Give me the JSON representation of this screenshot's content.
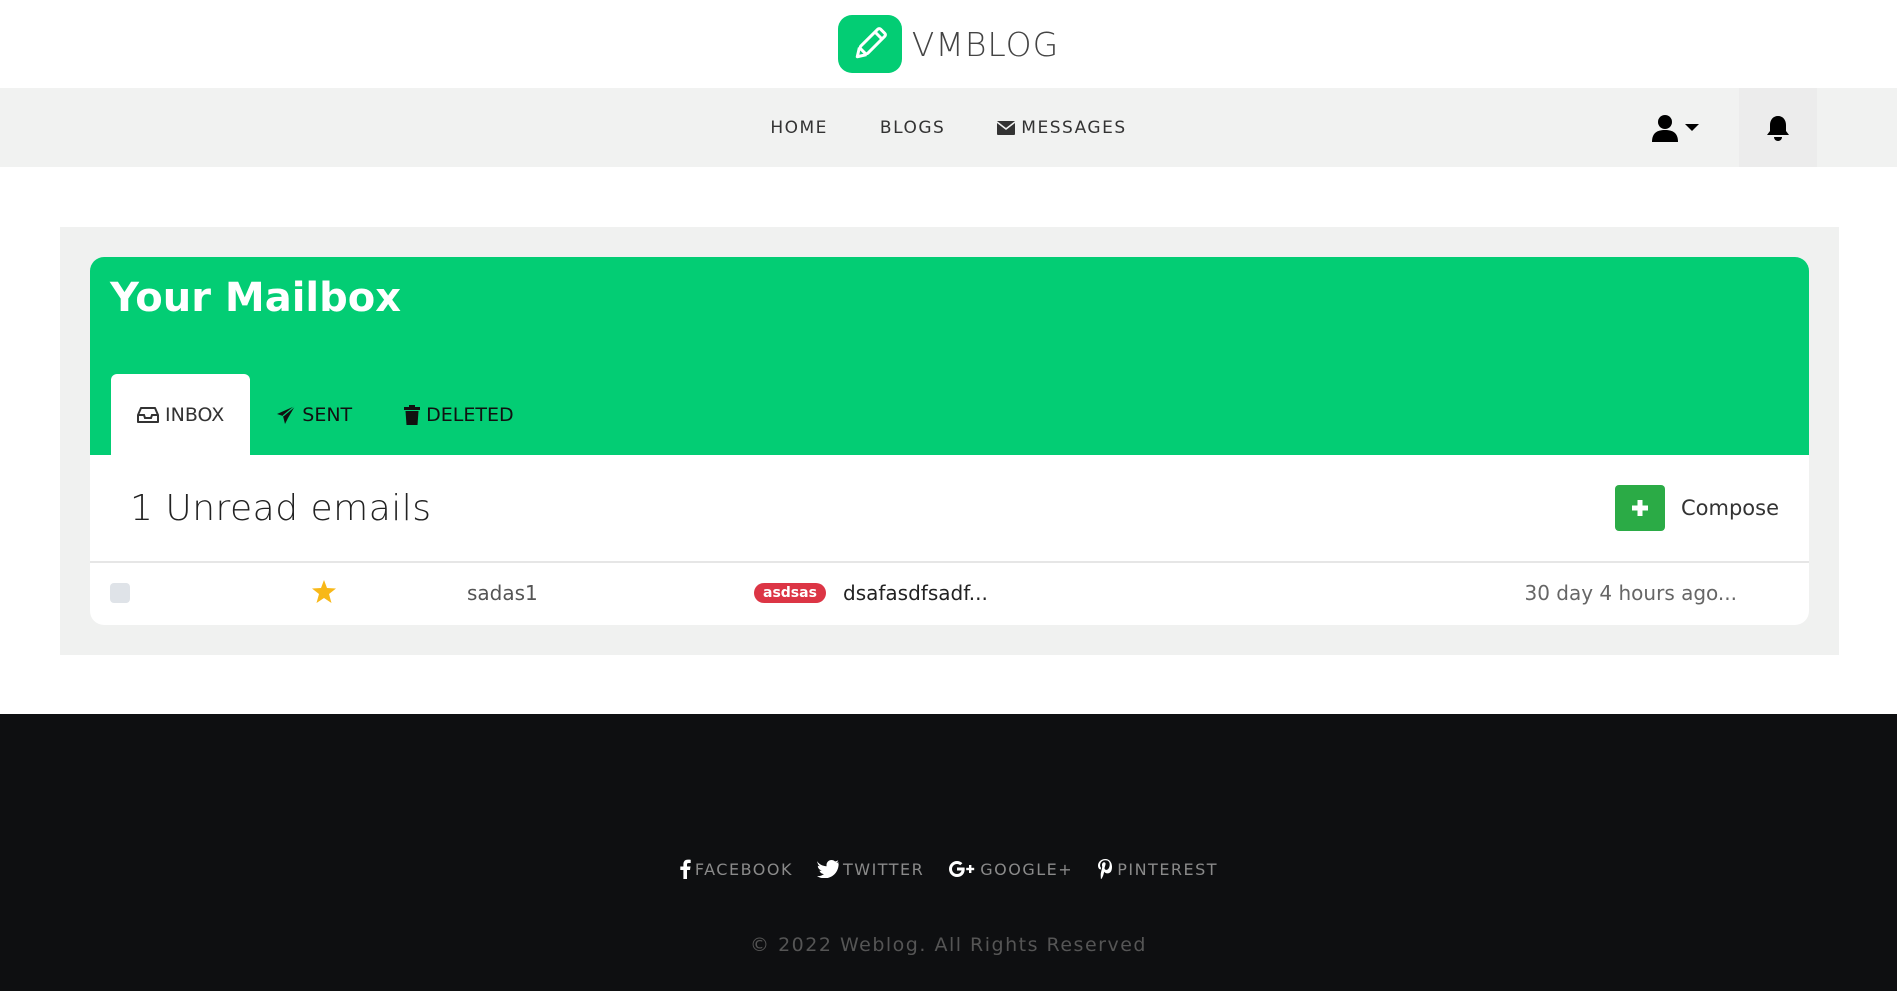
{
  "brand": {
    "name": "VMBLOG",
    "color": "#03cd74"
  },
  "nav": {
    "links": [
      "HOME",
      "BLOGS",
      "MESSAGES"
    ]
  },
  "mailbox": {
    "title": "Your Mailbox",
    "tabs": [
      {
        "label": "INBOX",
        "icon": "inbox-icon",
        "active": true
      },
      {
        "label": "SENT",
        "icon": "paper-plane-icon",
        "active": false
      },
      {
        "label": "DELETED",
        "icon": "trash-icon",
        "active": false
      }
    ],
    "unread_title": "1 Unread emails",
    "compose_label": "Compose",
    "emails": [
      {
        "sender": "sadas1",
        "tag": "asdsas",
        "subject": "dsafasdfsadf...",
        "time": "30 day 4 hours ago...",
        "starred": true
      }
    ]
  },
  "footer": {
    "socials": [
      "FACEBOOK",
      "TWITTER",
      "GOOGLE+",
      "PINTEREST"
    ],
    "copyright": "© 2022 Weblog. All Rights Reserved"
  }
}
